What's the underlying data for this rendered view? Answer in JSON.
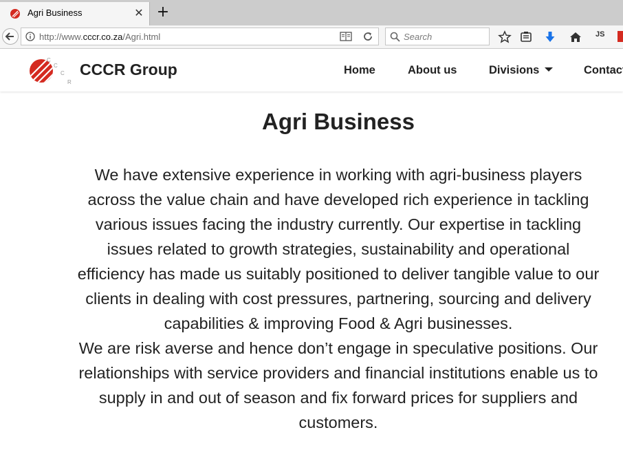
{
  "browser": {
    "tab": {
      "title": "Agri Business",
      "close_glyph": "✕"
    },
    "new_tab_glyph": "+",
    "url": {
      "prefix": "http://www.",
      "host": "cccr.co.za",
      "path": "/Agri.html"
    },
    "search_placeholder": "Search",
    "toolbar": {
      "js_label": "JS"
    },
    "icons": [
      "back-icon",
      "info-icon",
      "reader-view-icon",
      "reload-icon",
      "search-icon",
      "bookmark-star-icon",
      "reading-list-icon",
      "download-icon",
      "home-icon",
      "javascript-toggle-icon"
    ]
  },
  "site": {
    "logo_letters": [
      "C",
      "C",
      "C",
      "R"
    ],
    "brand": "CCCR Group",
    "nav": {
      "home": "Home",
      "about": "About us",
      "divisions": "Divisions",
      "contact": "Contact"
    },
    "colors": {
      "logo_red": "#d42a20",
      "text": "#222222",
      "download_blue": "#1a73e8"
    }
  },
  "main": {
    "title": "Agri Business",
    "paragraphs": [
      "We have extensive experience in working with agri-business players across the value chain and have developed rich experience in tackling various issues facing the industry currently. Our expertise in tackling issues related to growth strategies, sustainability and operational efficiency has made us suitably positioned to deliver tangible value to our clients in dealing with cost pressures, partnering, sourcing and delivery capabilities & improving Food & Agri businesses.",
      "We are risk averse and hence don’t engage in speculative positions. Our relationships with service providers and financial institutions enable us to supply in and out of season and fix forward prices for suppliers and customers."
    ]
  }
}
